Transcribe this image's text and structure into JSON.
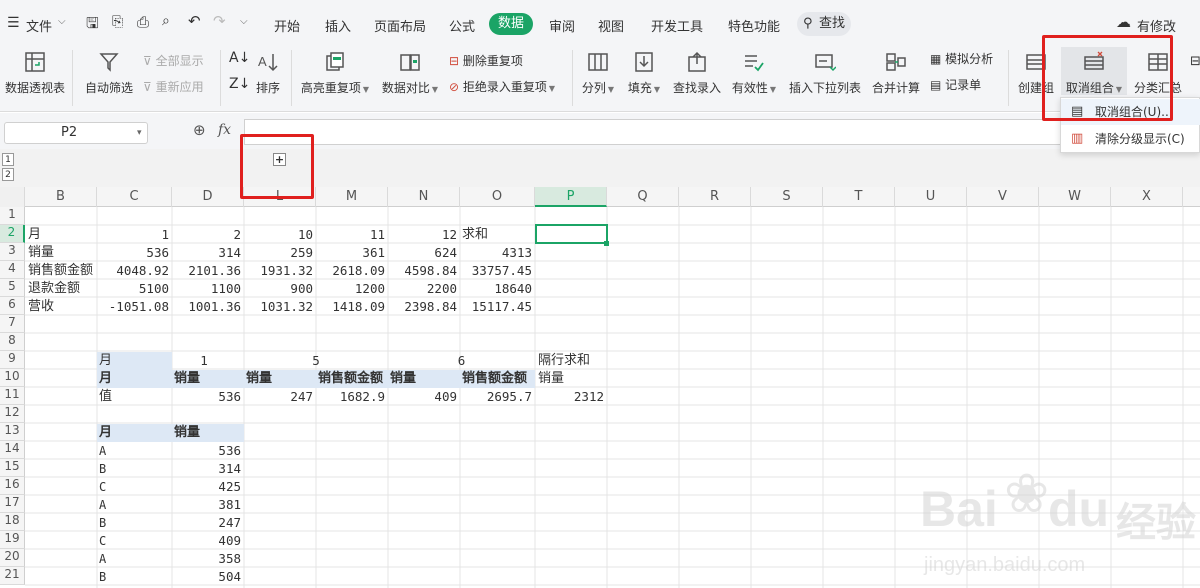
{
  "menubar": {
    "file": "文件",
    "tabs": [
      "开始",
      "插入",
      "页面布局",
      "公式",
      "数据",
      "审阅",
      "视图",
      "开发工具",
      "特色功能"
    ],
    "active_tab": "数据",
    "search": "查找",
    "changes": "有修改"
  },
  "ribbon": {
    "pivot": "数据透视表",
    "autofilter": "自动筛选",
    "show_all": "全部显示",
    "reapply": "重新应用",
    "sort": "排序",
    "highlight_dup": "高亮重复项",
    "compare": "数据对比",
    "remove_dup": "删除重复项",
    "reject_dup": "拒绝录入重复项",
    "split": "分列",
    "fill": "填充",
    "lookup": "查找录入",
    "validity": "有效性",
    "dropdown_list": "插入下拉列表",
    "consolidate": "合并计算",
    "simulate": "模拟分析",
    "records": "记录单",
    "create_group": "创建组",
    "ungroup": "取消组合",
    "subtotal": "分类汇总"
  },
  "dropdown": {
    "ungroup_item": "取消组合(U)...",
    "clear_outline": "清除分级显示(C)"
  },
  "formula": {
    "namebox": "P2",
    "fx": "fx",
    "content": ""
  },
  "outline": {
    "level1": "1",
    "level2": "2",
    "expand": "+"
  },
  "columns": [
    "B",
    "C",
    "D",
    "L",
    "M",
    "N",
    "O",
    "P",
    "Q",
    "R",
    "S",
    "T",
    "U",
    "V",
    "W",
    "X"
  ],
  "rows": [
    "1",
    "2",
    "3",
    "4",
    "5",
    "6",
    "7",
    "8",
    "9",
    "10",
    "11",
    "12",
    "13",
    "14",
    "15",
    "16",
    "17",
    "18",
    "19",
    "20",
    "21"
  ],
  "cells": {
    "r2": [
      "月",
      "1",
      "2",
      "10",
      "11",
      "12",
      "求和"
    ],
    "r3": [
      "销量",
      "536",
      "314",
      "259",
      "361",
      "624",
      "4313"
    ],
    "r4": [
      "销售额金额",
      "4048.92",
      "2101.36",
      "1931.32",
      "2618.09",
      "4598.84",
      "33757.45"
    ],
    "r5": [
      "退款金额",
      "5100",
      "1100",
      "900",
      "1200",
      "2200",
      "18640"
    ],
    "r6": [
      "营收",
      "-1051.08",
      "1001.36",
      "1031.32",
      "1418.09",
      "2398.84",
      "15117.45"
    ],
    "r9": [
      "月",
      "1",
      "5",
      "6",
      "隔行求和"
    ],
    "r10": [
      "月",
      "销量",
      "销量",
      "销售额金额",
      "销量",
      "销售额金额",
      "销量"
    ],
    "r11": [
      "值",
      "536",
      "247",
      "1682.9",
      "409",
      "2695.7",
      "2312"
    ],
    "r13": [
      "月",
      "销量"
    ],
    "list_months": [
      "A",
      "B",
      "C",
      "A",
      "B",
      "C",
      "A",
      "B"
    ],
    "list_sales": [
      "536",
      "314",
      "425",
      "381",
      "247",
      "409",
      "358",
      "504"
    ]
  },
  "watermark": {
    "brand": "Bai",
    "brand2": "du",
    "cn": "经验",
    "url": "jingyan.baidu.com"
  }
}
